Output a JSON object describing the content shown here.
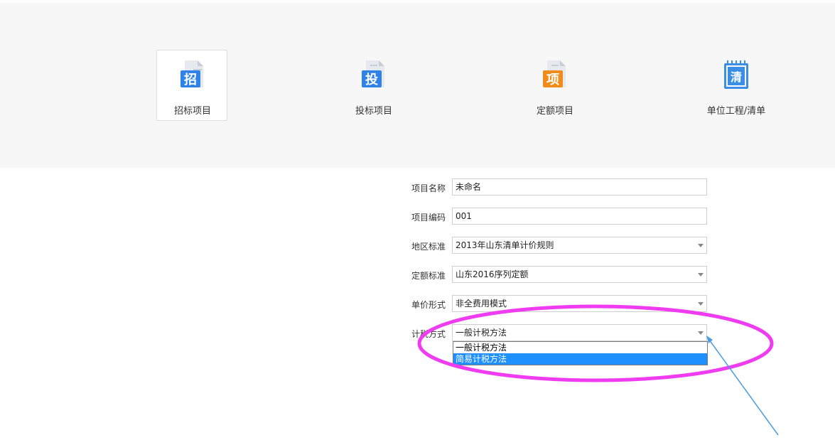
{
  "tiles": [
    {
      "label": "招标项目",
      "glyph": "招",
      "color": "#2f83e8",
      "active": true
    },
    {
      "label": "投标项目",
      "glyph": "投",
      "color": "#2f83e8",
      "active": false
    },
    {
      "label": "定额项目",
      "glyph": "项",
      "color": "#f08c1a",
      "active": false
    },
    {
      "label": "单位工程/清单",
      "glyph": "清",
      "color": "#3a8ee6",
      "active": false
    }
  ],
  "form": {
    "project_name": {
      "label": "项目名称",
      "value": "未命名"
    },
    "project_code": {
      "label": "项目编码",
      "value": "001"
    },
    "region_standard": {
      "label": "地区标准",
      "value": "2013年山东清单计价规则"
    },
    "quota_standard": {
      "label": "定额标准",
      "value": "山东2016序列定额"
    },
    "unit_price_form": {
      "label": "单价形式",
      "value": "非全费用模式"
    },
    "tax_method": {
      "label": "计税方式",
      "value": "一般计税方法",
      "options": [
        "一般计税方法",
        "简易计税方法"
      ],
      "highlighted_option": "简易计税方法"
    }
  },
  "annotation": {
    "ellipse_color": "#f03cf0",
    "arrow_color": "#4a9de0"
  }
}
